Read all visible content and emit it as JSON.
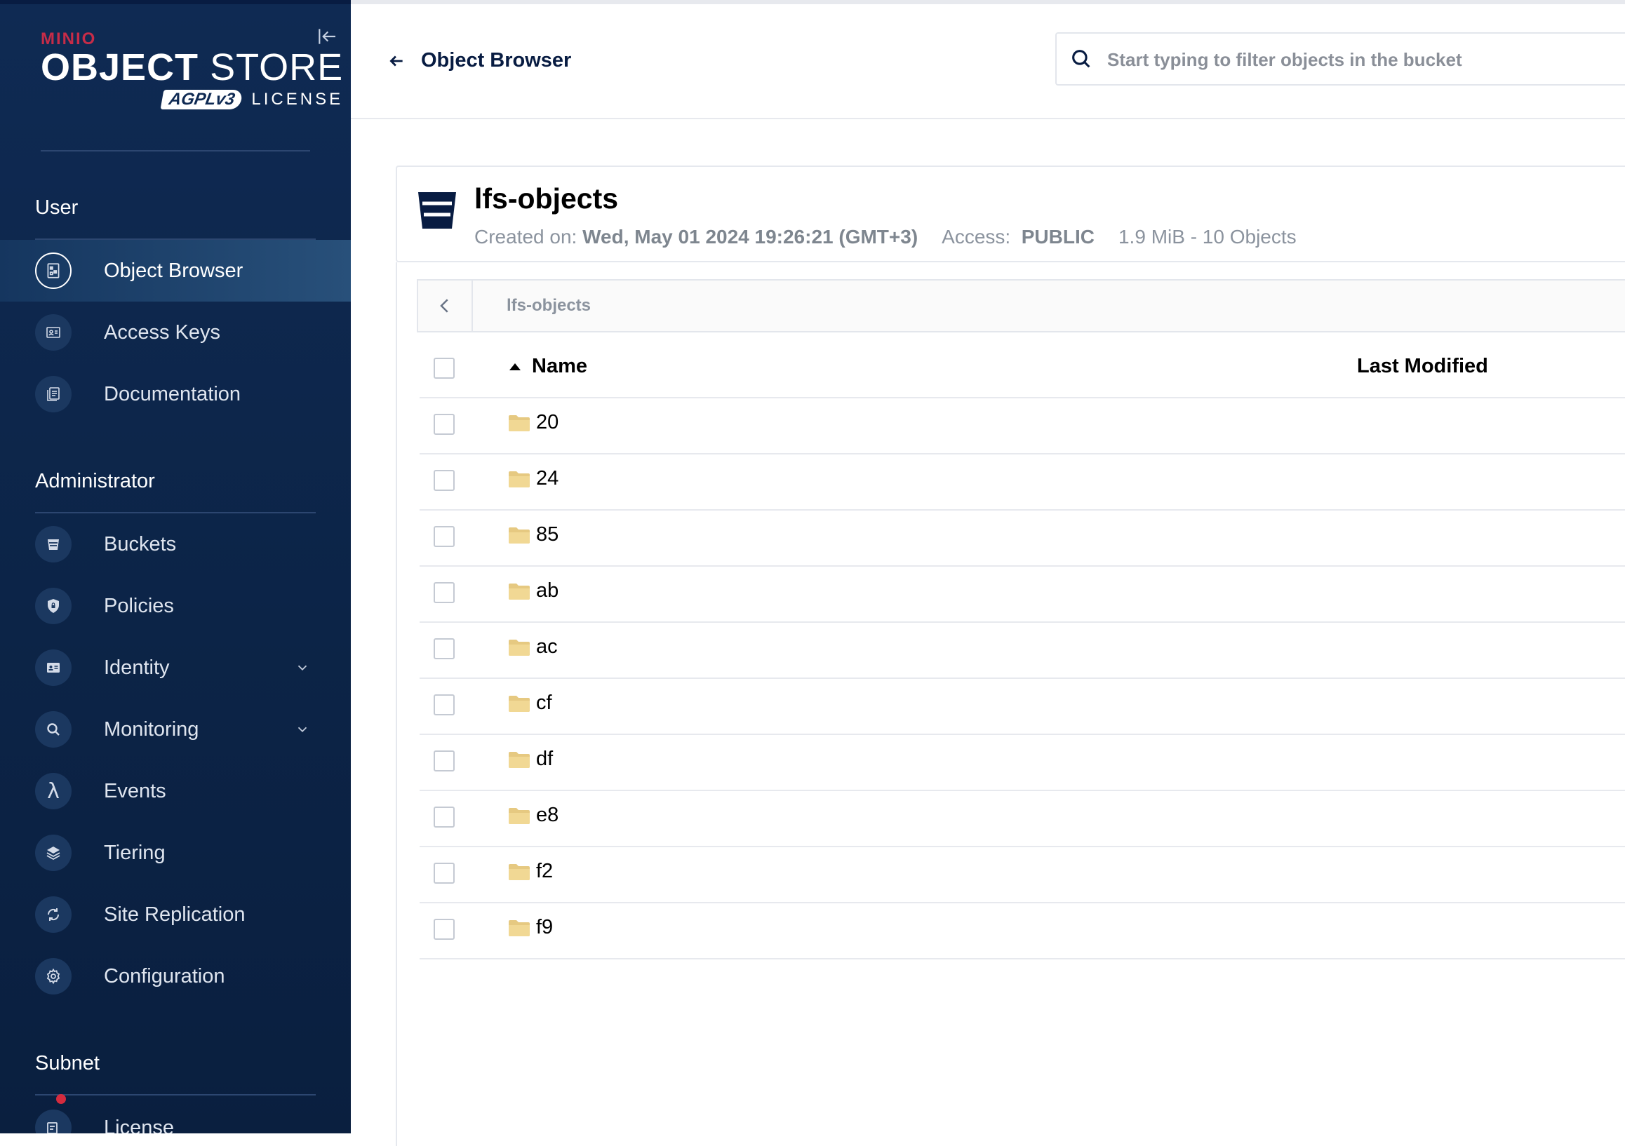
{
  "sidebar": {
    "brand": {
      "minio": "MINIO",
      "product_bold": "OBJECT",
      "product_light": "STORE",
      "agpl": "AGPLv3",
      "license": "LICENSE"
    },
    "sections": {
      "user": "User",
      "admin": "Administrator",
      "subnet": "Subnet"
    },
    "user_items": [
      {
        "label": "Object Browser",
        "icon": "object-browser-icon"
      },
      {
        "label": "Access Keys",
        "icon": "access-keys-icon"
      },
      {
        "label": "Documentation",
        "icon": "documentation-icon"
      }
    ],
    "admin_items": [
      {
        "label": "Buckets",
        "icon": "bucket-icon"
      },
      {
        "label": "Policies",
        "icon": "shield-lock-icon"
      },
      {
        "label": "Identity",
        "icon": "id-card-icon"
      },
      {
        "label": "Monitoring",
        "icon": "magnifier-icon"
      },
      {
        "label": "Events",
        "icon": "lambda-icon"
      },
      {
        "label": "Tiering",
        "icon": "layers-icon"
      },
      {
        "label": "Site Replication",
        "icon": "sync-icon"
      },
      {
        "label": "Configuration",
        "icon": "gear-icon"
      }
    ],
    "subnet_items": [
      {
        "label": "License",
        "icon": "license-icon"
      }
    ]
  },
  "header": {
    "back_label": "Object Browser",
    "search_placeholder": "Start typing to filter objects in the bucket"
  },
  "bucket": {
    "name": "lfs-objects",
    "created_label": "Created on:",
    "created_value": "Wed, May 01 2024 19:26:21 (GMT+3)",
    "access_label": "Access:",
    "access_value": "PUBLIC",
    "size_summary": "1.9 MiB - 10 Objects"
  },
  "browser": {
    "path": "lfs-objects",
    "columns": {
      "name": "Name",
      "last_modified": "Last Modified"
    },
    "rows": [
      "20",
      "24",
      "85",
      "ab",
      "ac",
      "cf",
      "df",
      "e8",
      "f2",
      "f9"
    ]
  },
  "colors": {
    "sidebar_bg": "#0f2a53",
    "accent": "#081c42",
    "brand_red": "#c72c48",
    "folder": "#e6c981"
  }
}
